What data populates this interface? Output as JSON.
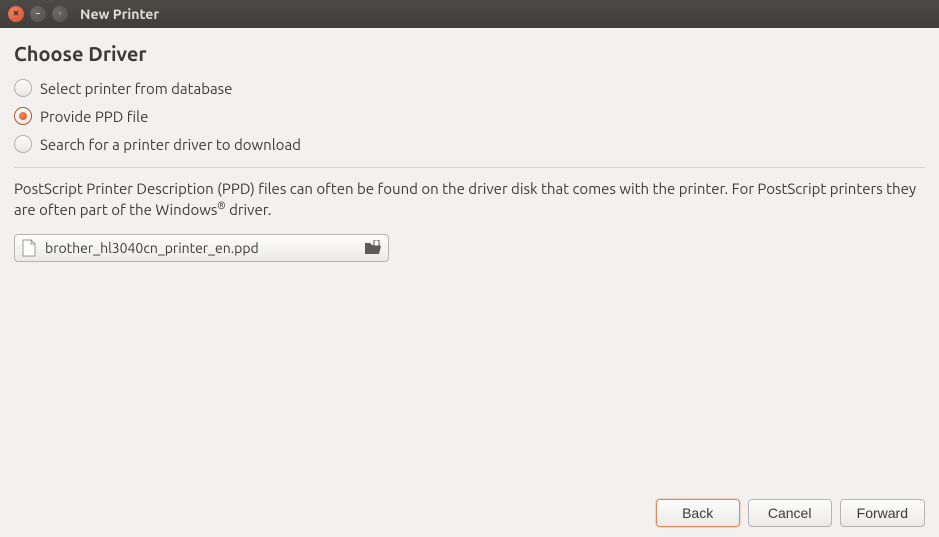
{
  "window": {
    "title": "New Printer"
  },
  "heading": "Choose Driver",
  "options": {
    "database": "Select printer from database",
    "ppd": "Provide PPD file",
    "search": "Search for a printer driver to download",
    "selected": "ppd"
  },
  "description_html": "PostScript Printer Description (PPD) files can often be found on the driver disk that comes with the printer. For PostScript printers they are often part of the Windows<sup>®</sup> driver.",
  "file": {
    "name": "brother_hl3040cn_printer_en.ppd"
  },
  "buttons": {
    "back": "Back",
    "cancel": "Cancel",
    "forward": "Forward"
  }
}
